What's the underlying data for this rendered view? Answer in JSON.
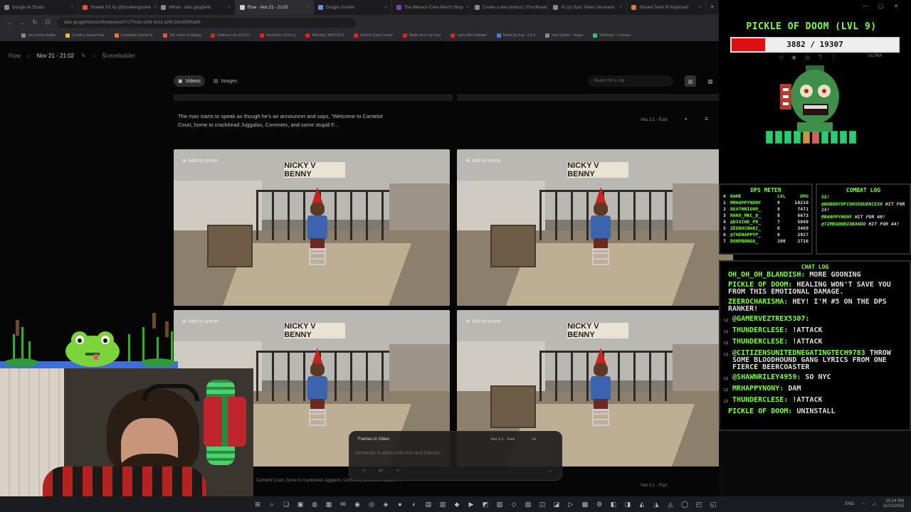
{
  "browser": {
    "tabs": [
      {
        "label": "Google AI Studio",
        "color": "#888888"
      },
      {
        "label": "Stream VS by @drunkengnome",
        "color": "#e0514a"
      },
      {
        "label": "Whisk - labs.google/fx",
        "color": "#888888"
      },
      {
        "label": "Flow - Nov 21 - 21:02",
        "color": "#cccccc"
      },
      {
        "label": "Google Gemini",
        "color": "#6d8cf0"
      },
      {
        "label": "The Menace Crew Merch Shop",
        "color": "#7c3fc7"
      },
      {
        "label": "Create a new product | Fourthwall",
        "color": "#888888"
      },
      {
        "label": "AI Lip Sync Video Generator",
        "color": "#888888"
      },
      {
        "label": "Stream Deck Pi Keyboard",
        "color": "#e07a2a"
      }
    ],
    "active_tab": 3,
    "url": "labs.google/fx/tools/flow/project/7c77fc41-e2fd-4d13-a26f-23cc663f0a66",
    "bookmarks": [
      {
        "label": "Jack Force Radio",
        "color": "#888888"
      },
      {
        "label": "Create a Sound Nea",
        "color": "#e0c040"
      },
      {
        "label": "Combined Speed Te",
        "color": "#e07a2a"
      },
      {
        "label": "The colors of Deliga",
        "color": "#e0514a"
      },
      {
        "label": "Deftone Live 2012 H",
        "color": "#e02020"
      },
      {
        "label": "Hard Bass 2015 (a",
        "color": "#e02020"
      },
      {
        "label": "Morning | WATCH D",
        "color": "#e02020"
      },
      {
        "label": "Electric Dairy Carnie",
        "color": "#e02020"
      },
      {
        "label": "Make Your Car Fast",
        "color": "#e02020"
      },
      {
        "label": "Just a Bit Forbidde",
        "color": "#e02020"
      },
      {
        "label": "Mixed by Kay - DJ S",
        "color": "#4a7de0"
      },
      {
        "label": "Star Citizen - Impas",
        "color": "#888888"
      },
      {
        "label": "VRchitect - Fursona",
        "color": "#3ac070"
      }
    ]
  },
  "flow": {
    "breadcrumb": {
      "root": "Flow",
      "project": "Nov 21 - 21:02",
      "section": "Scenebuilder"
    },
    "toolbar": {
      "videos": "Videos",
      "images": "Images"
    },
    "search_placeholder": "Search for a clip",
    "prompt_text": "The man starts to speak as though he's an announcer and says, \"Welcome to Camelot Court, home to crackhead Juggalos, Commies, and some stupid F...",
    "model_badge": "Veo 3.1 - Fast",
    "cards": [
      {
        "add_label": "Add to scene",
        "sign": "NICKY V BENNY"
      },
      {
        "add_label": "Add to scene",
        "sign": "NICKY V BENNY"
      },
      {
        "add_label": "Add to scene",
        "sign": "NICKY V BENNY"
      },
      {
        "add_label": "Add to scene",
        "sign": "NICKY V BENNY"
      }
    ],
    "composer": {
      "mode": "Frames to Video",
      "model": "Veo 3.1 - Fast",
      "count": "x4",
      "placeholder": "Generate a video with text and frames..."
    },
    "bottom_prompt": "Camelot Court, home to crackhead Juggalos, Commies, and some stupid F...",
    "bottom_meta": "Veo 3.1 - Fast"
  },
  "overlay": {
    "boss_name": "PICKLE OF DOOM (LVL 9)",
    "hp_current": 3882,
    "hp_max": 19307,
    "hp_text": "3882 / 19307",
    "ultra": "ULTRA",
    "pip_colors": [
      "#2ecc71",
      "#2ecc71",
      "#2ecc71",
      "#2ecc71",
      "#e08a3a",
      "#e05a5a",
      "#2ecc71",
      "#2ecc71",
      "#2ecc71",
      "#2ecc71"
    ],
    "dps": {
      "title": "DPS METER",
      "headers": [
        "#",
        "NAME",
        "LVL",
        "DMG"
      ],
      "rows": [
        {
          "rank": "1",
          "name": "MRHAPPYNONY",
          "lvl": "9",
          "dmg": "10210"
        },
        {
          "rank": "2",
          "name": "DEATHRIGHO_",
          "lvl": "8",
          "dmg": "7471"
        },
        {
          "rank": "3",
          "name": "MAKO_MKC_D_",
          "lvl": "8",
          "dmg": "6673"
        },
        {
          "rank": "4",
          "name": "@DIVINE_PR_",
          "lvl": "7",
          "dmg": "5049"
        },
        {
          "rank": "5",
          "name": "ZEEROCHARI_",
          "lvl": "6",
          "dmg": "3469"
        },
        {
          "rank": "6",
          "name": "@THEHAPPYP_",
          "lvl": "6",
          "dmg": "2927"
        },
        {
          "rank": "7",
          "name": "DONPBONGA_",
          "lvl": "100",
          "dmg": "2716"
        }
      ]
    },
    "combat": {
      "title": "COMBAT LOG",
      "lines": [
        {
          "pre": "",
          "user": "55!",
          "post": ""
        },
        {
          "pre": "",
          "user": "@NOBODYOFCONSEQUENCE50",
          "post": " HIT FOR 15!"
        },
        {
          "pre": "",
          "user": "MRHAPPYNONY",
          "post": " HIT FOR 60!"
        },
        {
          "pre": "",
          "user": "@TIMEGODDIDBANDO",
          "post": " HIT FOR 44!"
        }
      ]
    },
    "chat": {
      "title": "CHAT LOG",
      "messages": [
        {
          "lvl": "",
          "user": "OH_OH_OH_BLANDISH:",
          "text": "MORE GOONING"
        },
        {
          "lvl": "",
          "user": "PICKLE OF DOOM:",
          "text": "HEALING WON'T SAVE YOU FROM THIS EMOTIONAL DAMAGE."
        },
        {
          "lvl": "",
          "user": "ZEEROCHARISMA:",
          "text": "HEY! I'M #5 ON THE DPS RANKER!"
        },
        {
          "lvl": "L2",
          "user": "@GAMERVEZTREX5307:",
          "text": ""
        },
        {
          "lvl": "L2",
          "user": "THUNDERCLESE:",
          "text": "!ATTACK"
        },
        {
          "lvl": "L2",
          "user": "THUNDERCLESE:",
          "text": "!ATTACK"
        },
        {
          "lvl": "L2",
          "user": "@CITIZENSUNITEDNEGATINGTECH9783",
          "text": "THROW SOME BLOODHOUND GANG LYRICS FROM ONE FIERCE BEERCOASTER"
        },
        {
          "lvl": "L2",
          "user": "@SHAWNRILEY4959:",
          "text": "SO NYC"
        },
        {
          "lvl": "L2",
          "user": "MRHAPPYNONY:",
          "text": "DAM"
        },
        {
          "lvl": "L2",
          "user": "THUNDERCLESE:",
          "text": "!ATTACK"
        },
        {
          "lvl": "",
          "user": "PICKLE OF DOOM:",
          "text": "UNINSTALL"
        }
      ]
    }
  },
  "taskbar": {
    "icons": [
      "windows-icon",
      "search-icon",
      "taskview-icon",
      "explorer-icon",
      "edge-icon",
      "store-icon",
      "mail-icon",
      "steam-icon",
      "spotify-icon",
      "discord-icon",
      "obs-icon",
      "chrome-icon",
      "photoshop-icon",
      "premiere-icon",
      "vscode-icon",
      "terminal-icon",
      "davinci-icon",
      "notion-icon",
      "figma-icon",
      "slack-icon",
      "teams-icon",
      "zoom-icon",
      "vlc-icon",
      "calc-icon",
      "settings-icon",
      "epic-icon",
      "gog-icon",
      "battle-icon",
      "ubisoft-icon",
      "ea-icon",
      "xbox-icon",
      "onenote-icon",
      "chrome2-icon"
    ],
    "tray_lang": "ENG",
    "tray_time": "10:24 PM",
    "tray_date": "11/21/2025"
  }
}
